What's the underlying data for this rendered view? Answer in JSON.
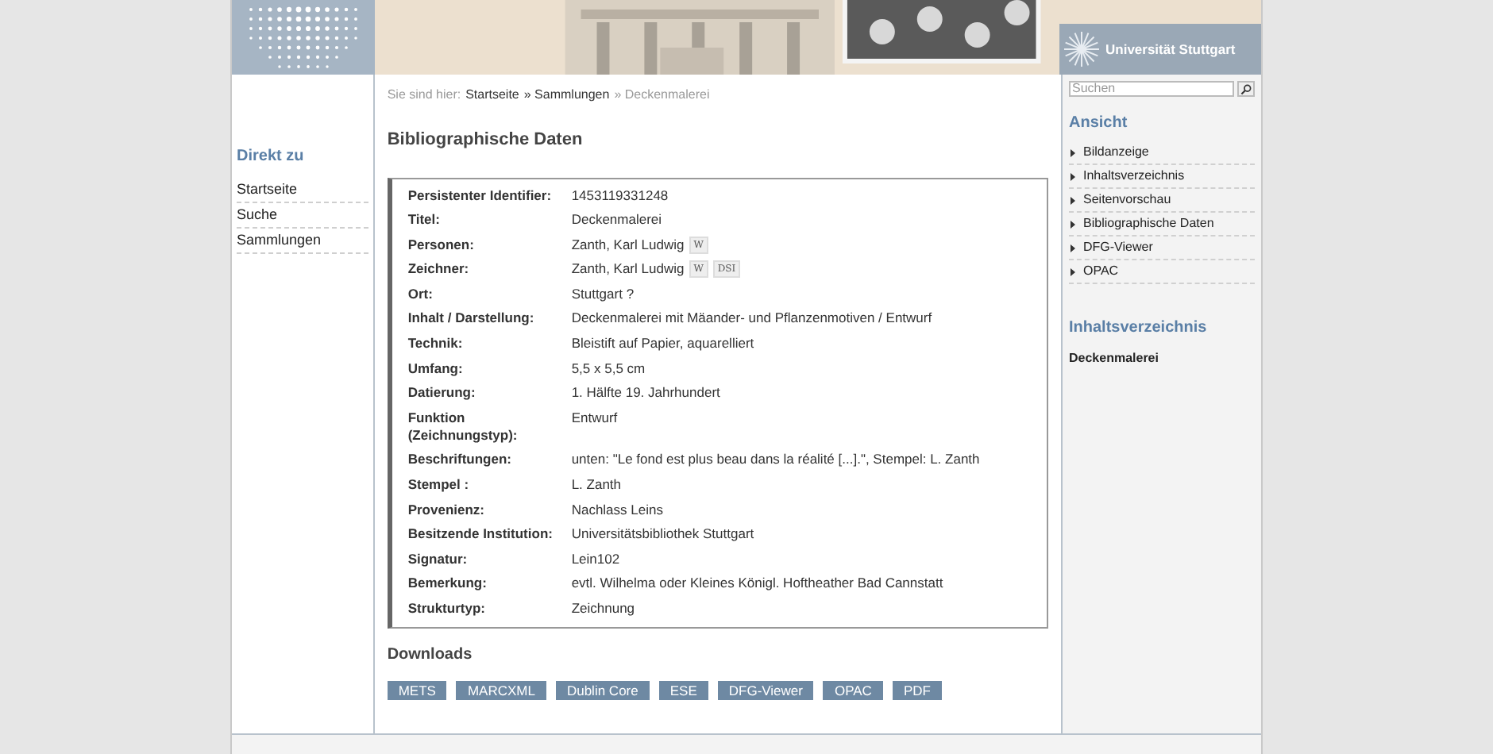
{
  "header": {
    "brand": "Universität Stuttgart"
  },
  "left_nav": {
    "heading": "Direkt zu",
    "items": [
      {
        "label": "Startseite"
      },
      {
        "label": "Suche"
      },
      {
        "label": "Sammlungen"
      }
    ]
  },
  "breadcrumb": {
    "prefix": "Sie sind hier:",
    "items": [
      {
        "label": "Startseite",
        "link": true
      },
      {
        "label": "» Sammlungen",
        "link": true
      },
      {
        "label": "» Deckenmalerei",
        "link": false
      }
    ]
  },
  "title": "Bibliographische Daten",
  "metadata": [
    {
      "label": "Persistenter Identifier:",
      "value": "1453119331248"
    },
    {
      "label": "Titel:",
      "value": "Deckenmalerei"
    },
    {
      "label": "Personen:",
      "value": "Zanth, Karl Ludwig",
      "tags": [
        "W"
      ]
    },
    {
      "label": "Zeichner:",
      "value": "Zanth, Karl Ludwig",
      "tags": [
        "W",
        "DSI"
      ]
    },
    {
      "label": "Ort:",
      "value": "Stuttgart ?"
    },
    {
      "label": "Inhalt / Darstellung:",
      "value": "Deckenmalerei mit Mäander- und Pflanzenmotiven / Entwurf"
    },
    {
      "label": "Technik:",
      "value": "Bleistift auf Papier, aquarelliert"
    },
    {
      "label": "Umfang:",
      "value": "5,5 x 5,5 cm"
    },
    {
      "label": "Datierung:",
      "value": "1. Hälfte 19. Jahrhundert"
    },
    {
      "label": "Funktion (Zeichnungstyp):",
      "value": "Entwurf"
    },
    {
      "label": "Beschriftungen:",
      "value": "unten: \"Le fond est plus beau dans la réalité [...].\", Stempel: L. Zanth"
    },
    {
      "label": "Stempel :",
      "value": "L. Zanth"
    },
    {
      "label": "Provenienz:",
      "value": "Nachlass Leins"
    },
    {
      "label": "Besitzende Institution:",
      "value": "Universitätsbibliothek Stuttgart"
    },
    {
      "label": "Signatur:",
      "value": "Lein102"
    },
    {
      "label": "Bemerkung:",
      "value": "evtl. Wilhelma oder Kleines Königl. Hoftheather Bad Cannstatt"
    },
    {
      "label": "Strukturtyp:",
      "value": "Zeichnung"
    }
  ],
  "downloads": {
    "heading": "Downloads",
    "buttons": [
      "METS",
      "MARCXML",
      "Dublin Core",
      "ESE",
      "DFG-Viewer",
      "OPAC",
      "PDF"
    ]
  },
  "search": {
    "placeholder": "Suchen"
  },
  "view_menu": {
    "heading": "Ansicht",
    "items": [
      {
        "label": "Bildanzeige"
      },
      {
        "label": "Inhaltsverzeichnis"
      },
      {
        "label": "Seitenvorschau"
      },
      {
        "label": "Bibliographische Daten"
      },
      {
        "label": "DFG-Viewer"
      },
      {
        "label": "OPAC"
      }
    ]
  },
  "toc": {
    "heading": "Inhaltsverzeichnis",
    "items": [
      {
        "label": "Deckenmalerei"
      }
    ]
  }
}
